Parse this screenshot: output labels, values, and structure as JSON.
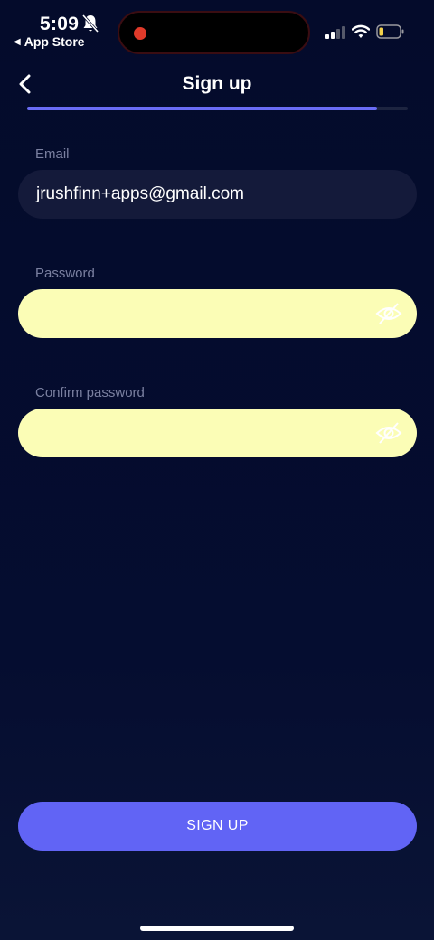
{
  "status_bar": {
    "time": "5:09",
    "back_app": "App Store",
    "back_arrow": "◀",
    "recording_color": "#e03a2a"
  },
  "nav": {
    "title": "Sign up",
    "back_icon": "chevron-left-icon"
  },
  "progress": {
    "fraction": 0.92,
    "color": "#6a6cf6"
  },
  "form": {
    "email": {
      "label": "Email",
      "value": "jrushfinn+apps@gmail.com"
    },
    "password": {
      "label": "Password",
      "value": "",
      "toggle_icon": "eye-off-icon"
    },
    "confirm_password": {
      "label": "Confirm password",
      "value": "",
      "toggle_icon": "eye-off-icon"
    }
  },
  "submit": {
    "label": "SIGN UP",
    "color": "#6164f5"
  },
  "colors": {
    "background": "#040b2b",
    "autofill_field": "#fbfdb6",
    "email_field": "#141a3a"
  }
}
